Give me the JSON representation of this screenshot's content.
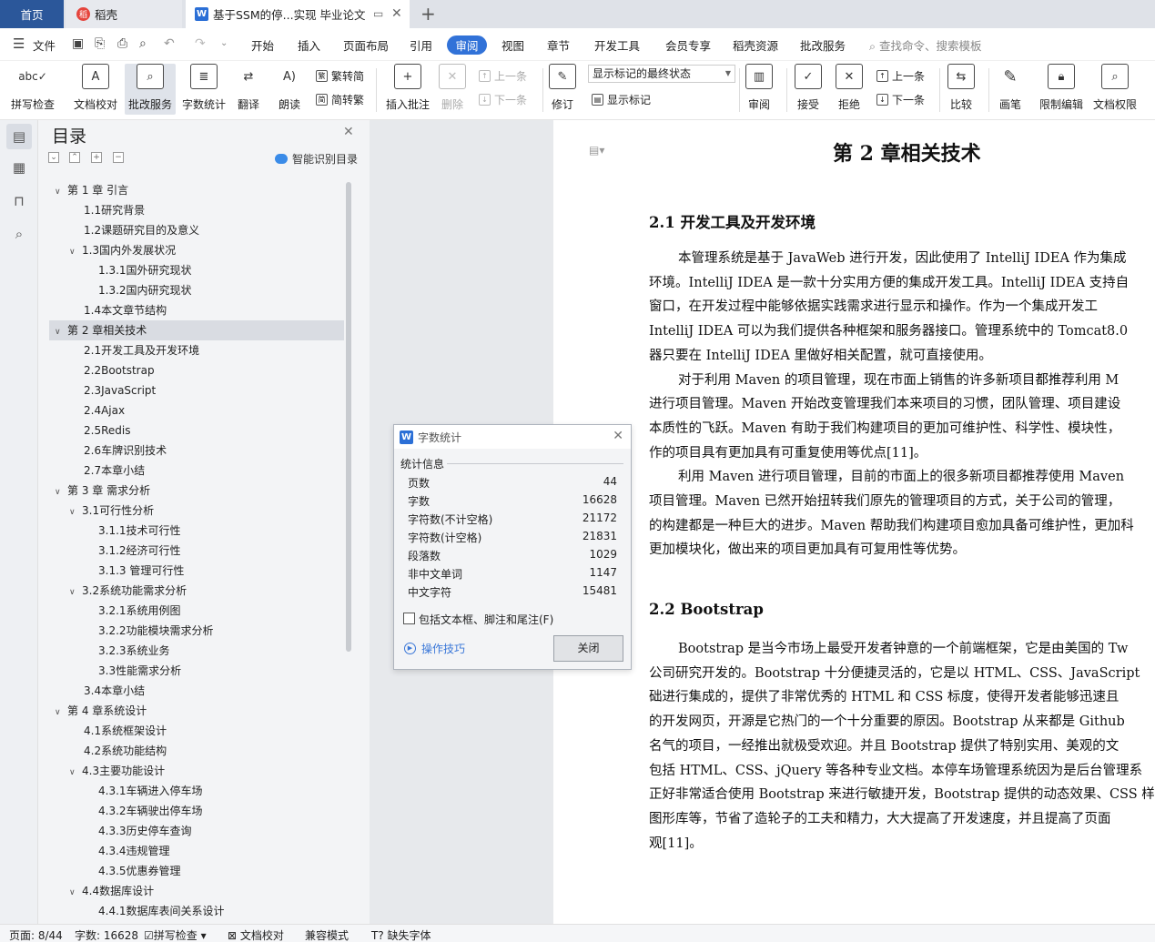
{
  "tabs": {
    "home": "首页",
    "daoke": "稻壳",
    "doc": "基于SSM的停...实现 毕业论文",
    "new_tab": "+"
  },
  "menu": {
    "file": "文件",
    "items": [
      "开始",
      "插入",
      "页面布局",
      "引用",
      "审阅",
      "视图",
      "章节",
      "开发工具",
      "会员专享",
      "稻壳资源",
      "批改服务"
    ],
    "active": "审阅",
    "search_placeholder": "查找命令、搜索模板"
  },
  "ribbon": {
    "spellcheck": "拼写检查",
    "doc_proof": "文档校对",
    "review_service": "批改服务",
    "word_count": "字数统计",
    "translate": "翻译",
    "read_aloud": "朗读",
    "trad_simp": "繁转简",
    "simp_trad": "简转繁",
    "insert_comment": "插入批注",
    "delete": "删除",
    "prev": "上一条",
    "next": "下一条",
    "revise": "修订",
    "markup_mode": "显示标记的最终状态",
    "show_markup": "显示标记",
    "review": "审阅",
    "accept": "接受",
    "reject": "拒绝",
    "prev2": "上一条",
    "next2": "下一条",
    "compare": "比较",
    "pen": "画笔",
    "restrict_edit": "限制编辑",
    "doc_permission": "文档权限"
  },
  "toc": {
    "title": "目录",
    "smart": "智能识别目录",
    "items": [
      {
        "text": "第 1 章  引言",
        "level": 1,
        "caret": "v"
      },
      {
        "text": "1.1研究背景",
        "level": 2,
        "caret": ""
      },
      {
        "text": "1.2课题研究目的及意义",
        "level": 2,
        "caret": ""
      },
      {
        "text": "1.3国内外发展状况",
        "level": 2,
        "caret": "v"
      },
      {
        "text": "1.3.1国外研究现状",
        "level": 3,
        "caret": ""
      },
      {
        "text": "1.3.2国内研究现状",
        "level": 3,
        "caret": ""
      },
      {
        "text": "1.4本文章节结构",
        "level": 2,
        "caret": ""
      },
      {
        "text": "第 2 章相关技术",
        "level": 1,
        "caret": "v"
      },
      {
        "text": "2.1开发工具及开发环境",
        "level": 2,
        "caret": ""
      },
      {
        "text": "2.2Bootstrap",
        "level": 2,
        "caret": ""
      },
      {
        "text": "2.3JavaScript",
        "level": 2,
        "caret": ""
      },
      {
        "text": "2.4Ajax",
        "level": 2,
        "caret": ""
      },
      {
        "text": "2.5Redis",
        "level": 2,
        "caret": ""
      },
      {
        "text": "2.6车牌识别技术",
        "level": 2,
        "caret": ""
      },
      {
        "text": "2.7本章小结",
        "level": 2,
        "caret": ""
      },
      {
        "text": "第 3 章  需求分析",
        "level": 1,
        "caret": "v"
      },
      {
        "text": "3.1可行性分析",
        "level": 2,
        "caret": "v"
      },
      {
        "text": "3.1.1技术可行性",
        "level": 3,
        "caret": ""
      },
      {
        "text": "3.1.2经济可行性",
        "level": 3,
        "caret": ""
      },
      {
        "text": "3.1.3  管理可行性",
        "level": 3,
        "caret": ""
      },
      {
        "text": "3.2系统功能需求分析",
        "level": 2,
        "caret": "v"
      },
      {
        "text": "3.2.1系统用例图",
        "level": 3,
        "caret": ""
      },
      {
        "text": "3.2.2功能模块需求分析",
        "level": 3,
        "caret": ""
      },
      {
        "text": "3.2.3系统业务",
        "level": 3,
        "caret": ""
      },
      {
        "text": "3.3性能需求分析",
        "level": 3,
        "caret": ""
      },
      {
        "text": "3.4本章小结",
        "level": 2,
        "caret": ""
      },
      {
        "text": "第 4 章系统设计",
        "level": 1,
        "caret": "v"
      },
      {
        "text": "4.1系统框架设计",
        "level": 2,
        "caret": ""
      },
      {
        "text": "4.2系统功能结构",
        "level": 2,
        "caret": ""
      },
      {
        "text": "4.3主要功能设计",
        "level": 2,
        "caret": "v"
      },
      {
        "text": "4.3.1车辆进入停车场",
        "level": 3,
        "caret": ""
      },
      {
        "text": "4.3.2车辆驶出停车场",
        "level": 3,
        "caret": ""
      },
      {
        "text": "4.3.3历史停车查询",
        "level": 3,
        "caret": ""
      },
      {
        "text": "4.3.4违规管理",
        "level": 3,
        "caret": ""
      },
      {
        "text": "4.3.5优惠券管理",
        "level": 3,
        "caret": ""
      },
      {
        "text": "4.4数据库设计",
        "level": 2,
        "caret": "v"
      },
      {
        "text": "4.4.1数据库表间关系设计",
        "level": 3,
        "caret": ""
      }
    ]
  },
  "document": {
    "chapter_title": "第 2 章相关技术",
    "sec1_title": "2.1  开发工具及开发环境",
    "sec1_lines": [
      "本管理系统是基于 JavaWeb 进行开发，因此使用了 IntelliJ IDEA 作为集成",
      "环境。IntelliJ IDEA 是一款十分实用方便的集成开发工具。IntelliJ IDEA 支持自",
      "窗口，在开发过程中能够依据实践需求进行显示和操作。作为一个集成开发工",
      "IntelliJ IDEA 可以为我们提供各种框架和服务器接口。管理系统中的 Tomcat8.0",
      "器只要在 IntelliJ IDEA 里做好相关配置，就可直接使用。",
      "对于利用 Maven 的项目管理，现在市面上销售的许多新项目都推荐利用 M",
      "进行项目管理。Maven 开始改变管理我们本来项目的习惯，团队管理、项目建设",
      "本质性的飞跃。Maven 有助于我们构建项目的更加可维护性、科学性、模块性，",
      "作的项目具有更加具有可重复使用等优点[11]。",
      "利用 Maven 进行项目管理，目前的市面上的很多新项目都推荐使用 Maven",
      "项目管理。Maven 已然开始扭转我们原先的管理项目的方式，关于公司的管理，",
      "的构建都是一种巨大的进步。Maven 帮助我们构建项目愈加具备可维护性，更加科",
      "更加模块化，做出来的项目更加具有可复用性等优势。"
    ],
    "sec2_title": "2.2  Bootstrap",
    "sec2_lines": [
      "Bootstrap 是当今市场上最受开发者钟意的一个前端框架，它是由美国的 Tw",
      "公司研究开发的。Bootstrap 十分便捷灵活的，它是以 HTML、CSS、JavaScript",
      "础进行集成的，提供了非常优秀的 HTML 和 CSS 标度，使得开发者能够迅速且",
      "的开发网页，开源是它热门的一个十分重要的原因。Bootstrap 从来都是 Github",
      "名气的项目，一经推出就极受欢迎。并且 Bootstrap 提供了特别实用、美观的文",
      "包括 HTML、CSS、jQuery 等各种专业文档。本停车场管理系统因为是后台管理系",
      "正好非常适合使用 Bootstrap 来进行敏捷开发，Bootstrap 提供的动态效果、CSS 样",
      "图形库等，节省了造轮子的工夫和精力，大大提高了开发速度，并且提高了页面",
      "观[11]。"
    ]
  },
  "dialog": {
    "title": "字数统计",
    "group": "统计信息",
    "rows": [
      {
        "label": "页数",
        "value": "44"
      },
      {
        "label": "字数",
        "value": "16628"
      },
      {
        "label": "字符数(不计空格)",
        "value": "21172"
      },
      {
        "label": "字符数(计空格)",
        "value": "21831"
      },
      {
        "label": "段落数",
        "value": "1029"
      },
      {
        "label": "非中文单词",
        "value": "1147"
      },
      {
        "label": "中文字符",
        "value": "15481"
      }
    ],
    "checkbox_label": "包括文本框、脚注和尾注(F)",
    "checkbox_checked": false,
    "tips": "操作技巧",
    "close_button": "关闭"
  },
  "status": {
    "page": "页面: 8/44",
    "words": "字数: 16628",
    "spell": "拼写检查",
    "proof": "文档校对",
    "compat": "兼容模式",
    "missing_font": "缺失字体"
  }
}
